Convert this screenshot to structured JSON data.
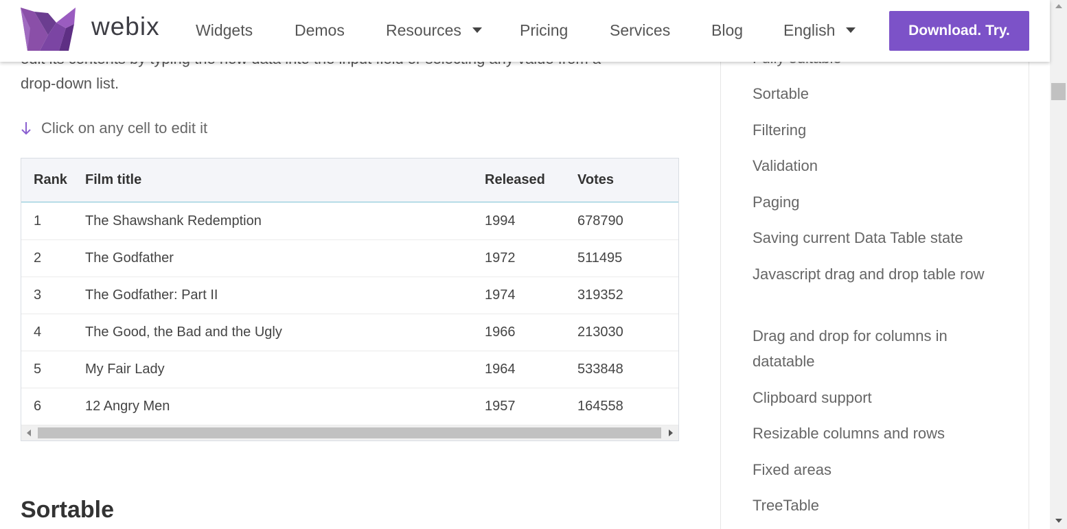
{
  "header": {
    "brand": "webix",
    "nav": [
      {
        "label": "Widgets"
      },
      {
        "label": "Demos"
      },
      {
        "label": "Resources"
      },
      {
        "label": "Pricing"
      },
      {
        "label": "Services"
      },
      {
        "label": "Blog"
      },
      {
        "label": "English"
      }
    ],
    "cta": "Download. Try.",
    "brand_color": "#7c52c8"
  },
  "main": {
    "intro_lines": [
      "edit its contents by typing the new data into the input field or selecting any value from a",
      "drop-down list."
    ],
    "hint": "Click on any cell to edit it",
    "hint_icon": "arrow-down-icon",
    "table": {
      "columns": [
        "Rank",
        "Film title",
        "Released",
        "Votes"
      ],
      "rows": [
        [
          "1",
          "The Shawshank Redemption",
          "1994",
          "678790"
        ],
        [
          "2",
          "The Godfather",
          "1972",
          "511495"
        ],
        [
          "3",
          "The Godfather: Part II",
          "1974",
          "319352"
        ],
        [
          "4",
          "The Good, the Bad and the Ugly",
          "1966",
          "213030"
        ],
        [
          "5",
          "My Fair Lady",
          "1964",
          "533848"
        ],
        [
          "6",
          "12 Angry Men",
          "1957",
          "164558"
        ]
      ]
    },
    "next_section_heading": "Sortable"
  },
  "sidebar": {
    "links": [
      {
        "label": "Fully editable"
      },
      {
        "label": "Sortable"
      },
      {
        "label": "Filtering"
      },
      {
        "label": "Validation"
      },
      {
        "label": "Paging"
      },
      {
        "label": "Saving current Data Table state"
      },
      {
        "label": "Javascript drag and drop table row"
      },
      {
        "label": "Drag and drop for columns in datatable"
      },
      {
        "label": "Clipboard support"
      },
      {
        "label": "Resizable columns and rows"
      },
      {
        "label": "Fixed areas"
      },
      {
        "label": "TreeTable"
      }
    ]
  }
}
